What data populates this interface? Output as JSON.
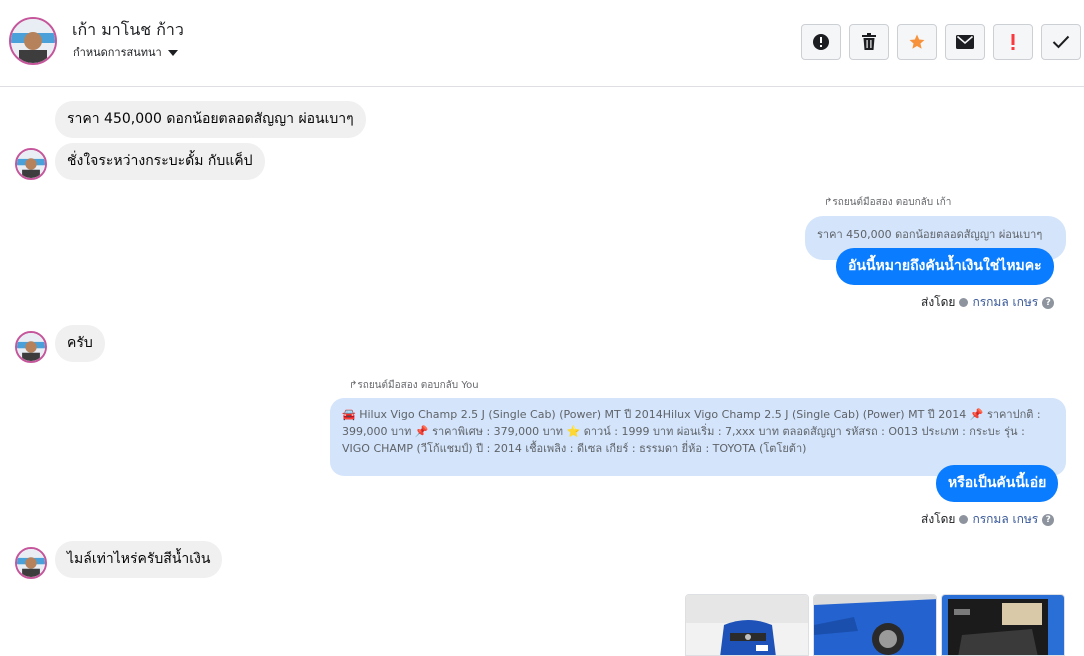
{
  "header": {
    "contact_name": "เก้า มาโนช ก้าว",
    "settings_label": "กำหนดการสนทนา",
    "buttons": [
      {
        "icon": "alert-circle-icon",
        "color": "#1c1e21"
      },
      {
        "icon": "trash-icon",
        "color": "#1c1e21"
      },
      {
        "icon": "star-icon",
        "color": "#f7923a"
      },
      {
        "icon": "envelope-icon",
        "color": "#1c1e21"
      },
      {
        "icon": "exclamation-icon",
        "color": "#fa383e"
      },
      {
        "icon": "check-icon",
        "color": "#1c1e21"
      }
    ]
  },
  "messages": {
    "m1": "ราคา 450,000 ดอกน้อยตลอดสัญญา ผ่อนเบาๆ",
    "m2": "ชั่งใจระหว่างกระบะดั้ม กับแค็ป",
    "reply1_label": "รถยนต์มือสอง ตอบกลับ เก้า",
    "reply1_quoted": "ราคา 450,000 ดอกน้อยตลอดสัญญา ผ่อนเบาๆ",
    "reply1_text": "อันนี้หมายถึงคันน้ำเงินใช่ไหมคะ",
    "sent_by_1": "ส่งโดย",
    "sent_by_name_1": "กรกมล เกษร",
    "m3": "ครับ",
    "reply2_label": "รถยนต์มือสอง ตอบกลับ You",
    "reply2_quoted": "🚘 Hilux Vigo Champ 2.5 J (Single Cab) (Power) MT ปี 2014Hilux Vigo Champ 2.5 J (Single Cab) (Power) MT ปี 2014 📌 ราคาปกติ : 399,000 บาท 📌 ราคาพิเศษ : 379,000 บาท ⭐ ดาวน์ : 1999 บาท ผ่อนเริ่ม : 7,xxx บาท ตลอดสัญญา รหัสรถ : O013 ประเภท : กระบะ รุ่น : VIGO CHAMP (วีโก้แชมป์) ปี : 2014 เชื้อเพลิง : ดีเซล เกียร์ : ธรรมดา ยี่ห้อ : TOYOTA (โตโยต้า)",
    "reply2_text": "หรือเป็นคันนี้เอ่ย",
    "sent_by_2": "ส่งโดย",
    "sent_by_name_2": "กรกมล เกษร",
    "m4": "ไมล์เท่าไหร่ครับสีน้ำเงิน"
  },
  "colors": {
    "outgoing": "#0a7cff",
    "incoming": "#f0f0f0",
    "quoted": "#d3e4fb",
    "avatar_ring": "#c6569b"
  }
}
